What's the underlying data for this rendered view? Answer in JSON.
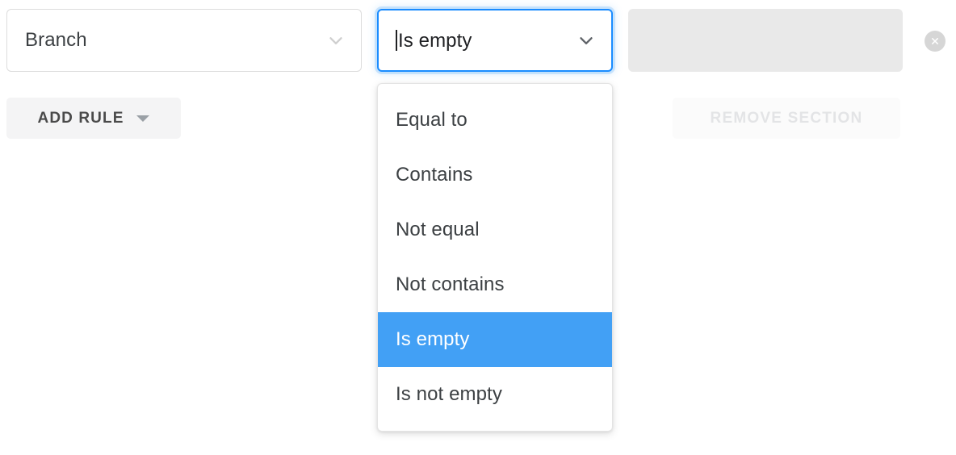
{
  "rule_row": {
    "attribute_field": {
      "value": "Branch",
      "icon": "chevron-down-icon"
    },
    "operator_field": {
      "value": "Is empty",
      "has_text_caret": true,
      "focused": true,
      "icon": "chevron-down-icon",
      "focus_color": "#1a8cff"
    },
    "value_field": {
      "value": "",
      "disabled": true,
      "background": "#e9e9e9"
    },
    "remove_rule_button": {
      "icon": "close-icon",
      "label": "",
      "background": "#d6d6d6"
    }
  },
  "actions": {
    "add_rule": {
      "label": "ADD RULE",
      "icon": "triangle-down-icon",
      "background": "#f4f4f5",
      "text_color": "#4a4a4a"
    },
    "remove_section": {
      "label": "REMOVE SECTION",
      "background": "#fbfbfb",
      "text_color": "#e3e4e6",
      "disabled": true
    }
  },
  "operator_menu": {
    "open": true,
    "selected_index": 4,
    "highlight_color": "#42a0f5",
    "items": [
      {
        "label": "Equal to"
      },
      {
        "label": "Contains"
      },
      {
        "label": "Not equal"
      },
      {
        "label": "Not contains"
      },
      {
        "label": "Is empty"
      },
      {
        "label": "Is not empty"
      }
    ]
  }
}
